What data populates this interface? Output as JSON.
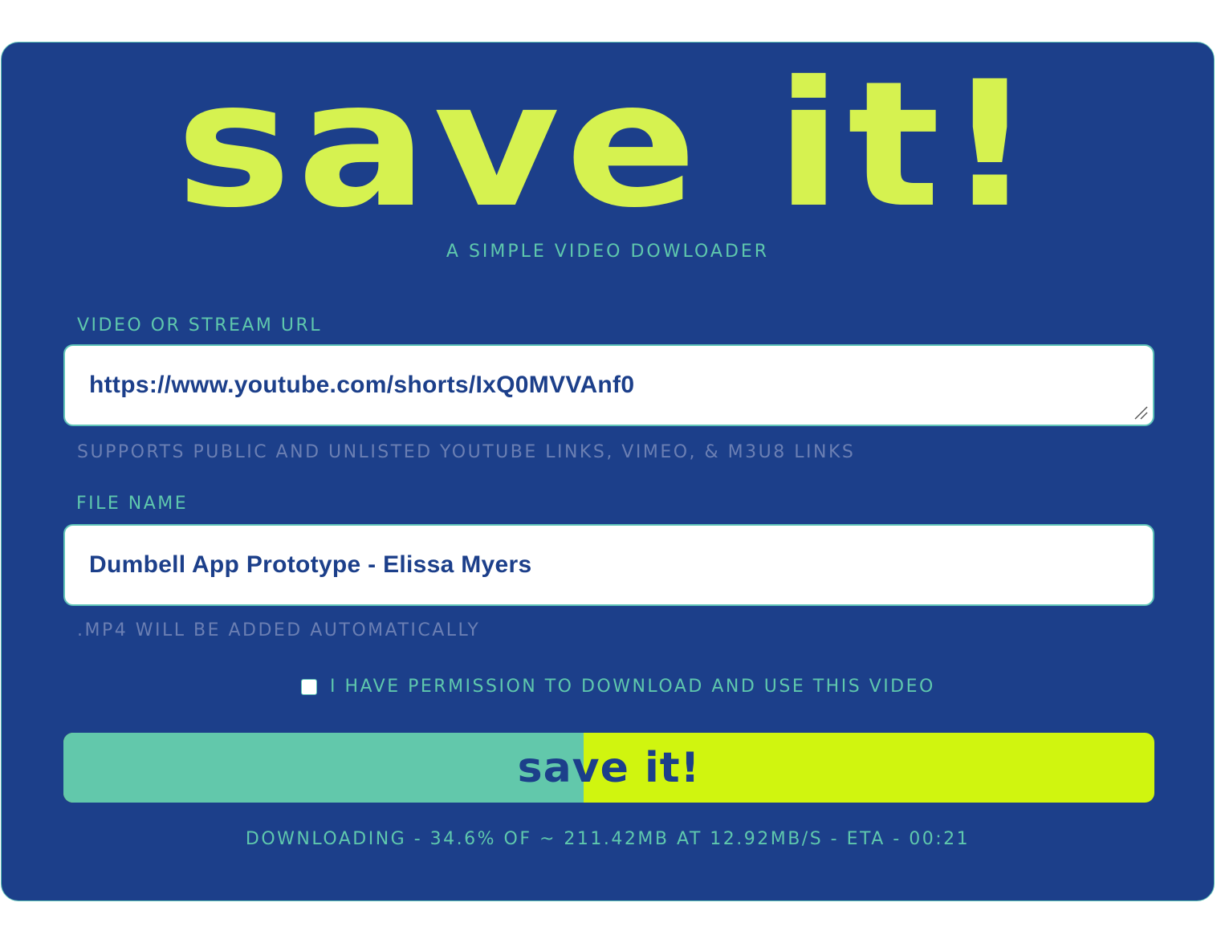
{
  "app": {
    "logo": "save it!",
    "subtitle": "A SIMPLE VIDEO DOWLOADER"
  },
  "url_field": {
    "label": "VIDEO OR STREAM URL",
    "value": "https://www.youtube.com/shorts/IxQ0MVVAnf0",
    "hint": "SUPPORTS PUBLIC AND UNLISTED YOUTUBE LINKS, VIMEO, & M3U8 LINKS"
  },
  "filename_field": {
    "label": "FILE NAME",
    "value": "Dumbell App Prototype - Elissa Myers",
    "hint": ".MP4 WILL BE ADDED AUTOMATICALLY"
  },
  "permission": {
    "label": "I HAVE PERMISSION TO DOWNLOAD AND USE THIS VIDEO",
    "checked": false
  },
  "save_button": {
    "label": "save it!",
    "progress_fraction": 0.477
  },
  "status": {
    "text": "DOWNLOADING - 34.6% OF ~ 211.42MB AT 12.92MB/S - ETA - 00:21"
  },
  "colors": {
    "background": "#1c3f8a",
    "accent": "#d6f250",
    "teal": "#5fc8ad",
    "button": "#d0f50f",
    "progress": "#62c8ab"
  },
  "icons": {
    "resize": "resize-grip-icon",
    "checkbox": "checkbox-icon"
  }
}
